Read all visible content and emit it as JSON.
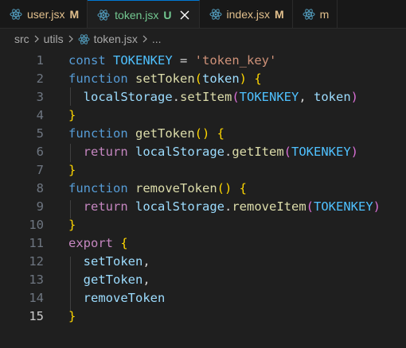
{
  "tabs": [
    {
      "name": "user.jsx",
      "status": "M",
      "active": false
    },
    {
      "name": "token.jsx",
      "status": "U",
      "active": true
    },
    {
      "name": "index.jsx",
      "status": "M",
      "active": false
    },
    {
      "name": "m",
      "status": "",
      "active": false
    }
  ],
  "breadcrumb": {
    "parts": [
      "src",
      "utils",
      "token.jsx",
      "..."
    ]
  },
  "editor": {
    "active_line": 15,
    "lines": [
      {
        "num": "1"
      },
      {
        "num": "2"
      },
      {
        "num": "3"
      },
      {
        "num": "4"
      },
      {
        "num": "5"
      },
      {
        "num": "6"
      },
      {
        "num": "7"
      },
      {
        "num": "8"
      },
      {
        "num": "9"
      },
      {
        "num": "10"
      },
      {
        "num": "11"
      },
      {
        "num": "12"
      },
      {
        "num": "13"
      },
      {
        "num": "14"
      },
      {
        "num": "15"
      }
    ],
    "tokens": {
      "const_kw": "const",
      "tokenkey": "TOKENKEY",
      "eq": " = ",
      "str": "'token_key'",
      "function_kw": "function",
      "set_token": "setToken",
      "get_token": "getToken",
      "remove_token": "removeToken",
      "param_token": "token",
      "local_storage": "localStorage",
      "dot": ".",
      "set_item": "setItem",
      "get_item": "getItem",
      "remove_item": "removeItem",
      "comma": ", ",
      "return_kw": "return",
      "export_kw": "export",
      "lparen": "(",
      "rparen": ")",
      "lbrace": "{",
      "rbrace": "}",
      "empty_parens": "()",
      "trailing_comma": ","
    }
  }
}
